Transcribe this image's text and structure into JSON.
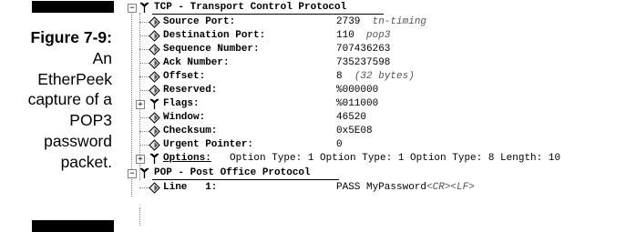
{
  "caption": {
    "figure_label": "Figure 7-9:",
    "lines": [
      "An",
      "EtherPeek",
      "capture of a",
      "POP3",
      "password",
      "packet."
    ]
  },
  "tcp": {
    "header": "TCP - Transport Control Protocol",
    "fields": [
      {
        "label": "Source Port:",
        "value": "2739",
        "desc": "tn-timing"
      },
      {
        "label": "Destination Port:",
        "value": "110",
        "desc": "pop3"
      },
      {
        "label": "Sequence Number:",
        "value": "707436263",
        "desc": ""
      },
      {
        "label": "Ack Number:",
        "value": "735237598",
        "desc": ""
      },
      {
        "label": "Offset:",
        "value": "8",
        "desc": "(32 bytes)"
      },
      {
        "label": "Reserved:",
        "value": "%000000",
        "desc": ""
      },
      {
        "label": "Flags:",
        "value": "%011000",
        "desc": ""
      },
      {
        "label": "Window:",
        "value": "46520",
        "desc": ""
      },
      {
        "label": "Checksum:",
        "value": "0x5E08",
        "desc": ""
      },
      {
        "label": "Urgent Pointer:",
        "value": "0",
        "desc": ""
      }
    ],
    "options": {
      "label": "Options:",
      "text": "Option Type: 1 Option Type: 1 Option Type: 8 Length: 10"
    }
  },
  "pop": {
    "header": "POP - Post Office Protocol",
    "line_label": "Line   1:",
    "line_value": "PASS MyPassword",
    "line_suffix": "<CR><LF>"
  },
  "icons": {
    "protocol": "antenna-protocol-icon",
    "field": "diamond-field-icon",
    "expand": "plus-box-icon",
    "collapse": "minus-box-icon"
  }
}
